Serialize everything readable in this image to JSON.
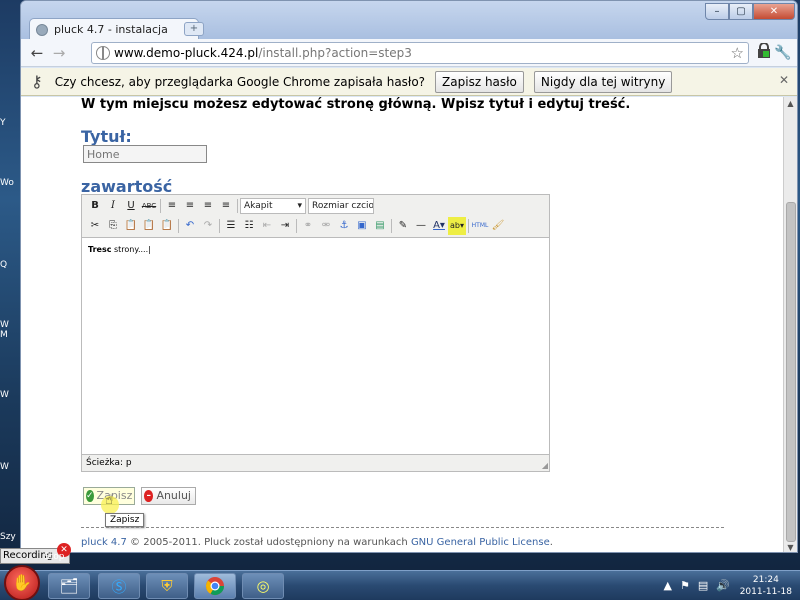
{
  "window": {
    "tab_title": "pluck 4.7 - instalacja",
    "tab_close": "×",
    "new_tab": "+",
    "controls": {
      "minimize": "–",
      "maximize": "▢",
      "close": "✕"
    }
  },
  "toolbar": {
    "back": "←",
    "forward": "→",
    "url_host": "www.demo-pluck.424.pl",
    "url_path": "/install.php?action=step3",
    "star": "☆",
    "wrench": "🔧"
  },
  "infobar": {
    "message": "Czy chcesz, aby przeglądarka Google Chrome zapisała hasło?",
    "save_password": "Zapisz hasło",
    "never_for_site": "Nigdy dla tej witryny",
    "close": "✕"
  },
  "page": {
    "intro": "W tym miejscu możesz edytować stronę główną. Wpisz tytuł i edytuj treść.",
    "title_heading": "Tytuł:",
    "title_placeholder": "Home",
    "content_heading": "zawartość",
    "editor": {
      "format_select": "Akapit",
      "size_select": "Rozmiar czcion",
      "body_bold": "Tresc",
      "body_text": " strony....",
      "path_label": "Ścieżka: p"
    },
    "save_button": "Zapisz",
    "cancel_button": "Anuluj",
    "tooltip": "Zapisz",
    "footer_link1": "pluck 4.7",
    "footer_text": " © 2005-2011. Pluck został udostępniony na warunkach ",
    "footer_link2": "GNU General Public License",
    "footer_end": "."
  },
  "desktop": {
    "widget_label": "Recording",
    "widget_stop": "Stop",
    "side_labels": [
      "Y",
      "Wo",
      "Q",
      "W\nM",
      "W",
      "W",
      "Szy"
    ]
  },
  "taskbar": {
    "clock_time": "21:24",
    "clock_date": "2011-11-18"
  }
}
